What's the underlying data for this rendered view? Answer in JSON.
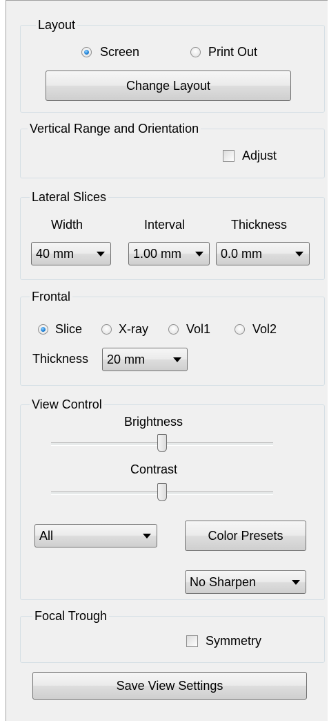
{
  "layout": {
    "title": "Layout",
    "screen_label": "Screen",
    "printout_label": "Print Out",
    "selected": "Screen",
    "change_button": "Change Layout"
  },
  "vertical": {
    "title": "Vertical Range and Orientation",
    "adjust_label": "Adjust",
    "adjust_checked": false
  },
  "lateral": {
    "title": "Lateral Slices",
    "width_label": "Width",
    "interval_label": "Interval",
    "thickness_label": "Thickness",
    "width_value": "40 mm",
    "interval_value": "1.00 mm",
    "thickness_value": "0.0 mm"
  },
  "frontal": {
    "title": "Frontal",
    "options": [
      "Slice",
      "X-ray",
      "Vol1",
      "Vol2"
    ],
    "selected": "Slice",
    "thickness_label": "Thickness",
    "thickness_value": "20 mm"
  },
  "view": {
    "title": "View Control",
    "brightness_label": "Brightness",
    "brightness_level": 0.5,
    "contrast_label": "Contrast",
    "contrast_level": 0.5,
    "filter_value": "All",
    "color_presets_button": "Color Presets",
    "sharpen_value": "No Sharpen"
  },
  "focal": {
    "title": "Focal Trough",
    "symmetry_label": "Symmetry",
    "symmetry_checked": false
  },
  "save_button": "Save View Settings"
}
